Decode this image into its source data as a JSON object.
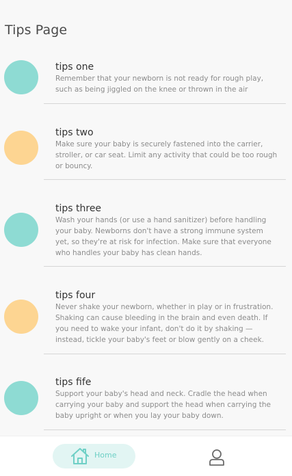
{
  "page": {
    "title": "Tips Page"
  },
  "tips": [
    {
      "title": "tips one",
      "body": "Remember that your newborn is not ready for rough play, such as being jiggled on the knee or thrown in the air",
      "dot_color": "#8edbd3"
    },
    {
      "title": "tips two",
      "body": "Make sure your baby is securely fastened into the carrier, stroller, or car seat. Limit any activity that could be too rough or bouncy.",
      "dot_color": "#fdd592"
    },
    {
      "title": "tips three",
      "body": "Wash your hands (or use a hand sanitizer) before handling your baby. Newborns don't have a strong immune system yet, so they're at risk for infection. Make sure that everyone who handles your baby has clean hands.",
      "dot_color": "#8edbd3"
    },
    {
      "title": "tips four",
      "body": "Never shake your newborn, whether in play or in frustration. Shaking can cause bleeding in the brain and even death. If you need to wake your infant, don't do it by shaking — instead, tickle your baby's feet or blow gently on a cheek.",
      "dot_color": "#fdd592"
    },
    {
      "title": "tips fife",
      "body": "Support your baby's head and neck. Cradle the head when carrying your baby and support the head when carrying the baby upright or when you lay your baby down.",
      "dot_color": "#8edbd3"
    }
  ],
  "nav": {
    "home_label": "Home",
    "home_icon": "home-icon",
    "profile_icon": "user-icon",
    "accent": "#6fd0c6",
    "active_bg": "#e2f5f3"
  }
}
